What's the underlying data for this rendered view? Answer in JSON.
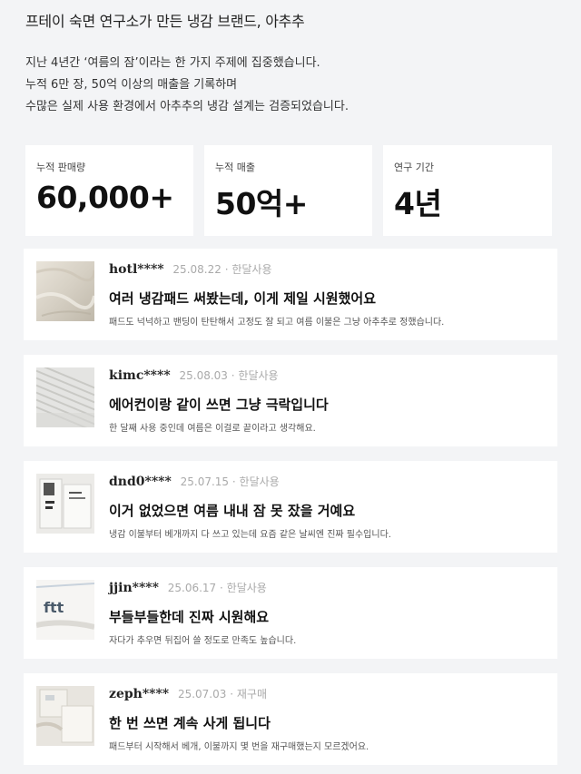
{
  "header": {
    "title": "프테이 숙면 연구소가 만든 냉감 브랜드, 아추추"
  },
  "intro": {
    "lines": [
      "지난 4년간 ‘여름의 잠’이라는 한 가지 주제에 집중했습니다.",
      "누적 6만 장, 50억 이상의 매출을 기록하며",
      "수많은 실제 사용 환경에서 아추추의 냉감 설계는 검증되었습니다."
    ]
  },
  "stats": [
    {
      "label": "누적 판매량",
      "value": "60,000+"
    },
    {
      "label": "누적 매출",
      "value": "50억+"
    },
    {
      "label": "연구 기간",
      "value": "4년"
    }
  ],
  "reviews": [
    {
      "user": "hotl****",
      "date": "25.08.22",
      "tag": "한달사용",
      "title": "여러 냉감패드 써봤는데, 이게 제일 시원했어요",
      "body": "패드도 넉넉하고 밴딩이 탄탄해서 고정도 잘 되고 여름 이불은 그냥 아추추로 정했습니다.",
      "thumb_text": ""
    },
    {
      "user": "kimc****",
      "date": "25.08.03",
      "tag": "한달사용",
      "title": "에어컨이랑 같이 쓰면 그냥 극락입니다",
      "body": "한 달째 사용 중인데 여름은 이걸로 끝이라고 생각해요.",
      "thumb_text": ""
    },
    {
      "user": "dnd0****",
      "date": "25.07.15",
      "tag": "한달사용",
      "title": "이거 없었으면 여름 내내 잠 못 잤을 거예요",
      "body": "냉감 이불부터 베개까지 다 쓰고 있는데 요즘 같은 날씨엔 진짜 필수입니다.",
      "thumb_text": ""
    },
    {
      "user": "jjin****",
      "date": "25.06.17",
      "tag": "한달사용",
      "title": "부들부들한데 진짜 시원해요",
      "body": "자다가 추우면 뒤집어 쓸 정도로 만족도 높습니다.",
      "thumb_text": "ftt"
    },
    {
      "user": "zeph****",
      "date": "25.07.03",
      "tag": "재구매",
      "title": "한 번 쓰면 계속 사게 됩니다",
      "body": "패드부터 시작해서 베개, 이불까지 몇 번을 재구매했는지 모르겠어요.",
      "thumb_text": ""
    }
  ],
  "colors": {
    "page_bg": "#f3f4f6",
    "card_bg": "#ffffff",
    "meta_gray": "#aaaaaa"
  }
}
